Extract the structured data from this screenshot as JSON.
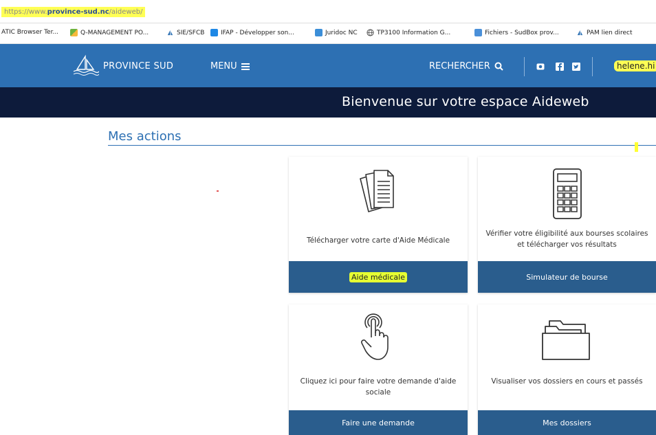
{
  "browser": {
    "url_prefix": "https://www.",
    "url_domain": "province-sud.nc",
    "url_path": "/aideweb/",
    "bookmarks": [
      {
        "label": "ATIC Browser Ter...",
        "icon": "page-icon"
      },
      {
        "label": "Q-MANAGEMENT PO...",
        "icon": "chart-icon"
      },
      {
        "label": "SIE/SFCB",
        "icon": "sail-icon"
      },
      {
        "label": "IFAP - Développer son...",
        "icon": "trello-icon"
      },
      {
        "label": "Juridoc NC",
        "icon": "book-icon"
      },
      {
        "label": "TP3100 Information G...",
        "icon": "globe-icon"
      },
      {
        "label": "Fichiers - SudBox prov...",
        "icon": "cloud-icon"
      },
      {
        "label": "PAM lien direct",
        "icon": "sail-icon"
      }
    ]
  },
  "nav": {
    "brand": "PROVINCE SUD",
    "menu_label": "MENU",
    "search_label": "RECHERCHER",
    "user_name": "helene.hi"
  },
  "banner": {
    "title": "Bienvenue sur votre espace Aideweb"
  },
  "section": {
    "title": "Mes actions"
  },
  "cards": [
    {
      "icon": "document-icon",
      "text": "Télécharger votre carte d'Aide Médicale",
      "button": "Aide médicale"
    },
    {
      "icon": "calculator-icon",
      "text": "Vérifier votre éligibilité aux bourses scolaires et télécharger vos résultats",
      "button": "Simulateur de bourse"
    },
    {
      "icon": "hand-pointer-icon",
      "text": "Cliquez ici pour faire votre demande d'aide sociale",
      "button": "Faire une demande"
    },
    {
      "icon": "folder-icon",
      "text": "Visualiser vos dossiers en cours et passés",
      "button": "Mes dossiers"
    }
  ],
  "colors": {
    "nav_blue": "#2d70b3",
    "banner_navy": "#0d1b3b",
    "button_blue": "#2a5d8d",
    "highlight_yellow": "#ffff55"
  }
}
